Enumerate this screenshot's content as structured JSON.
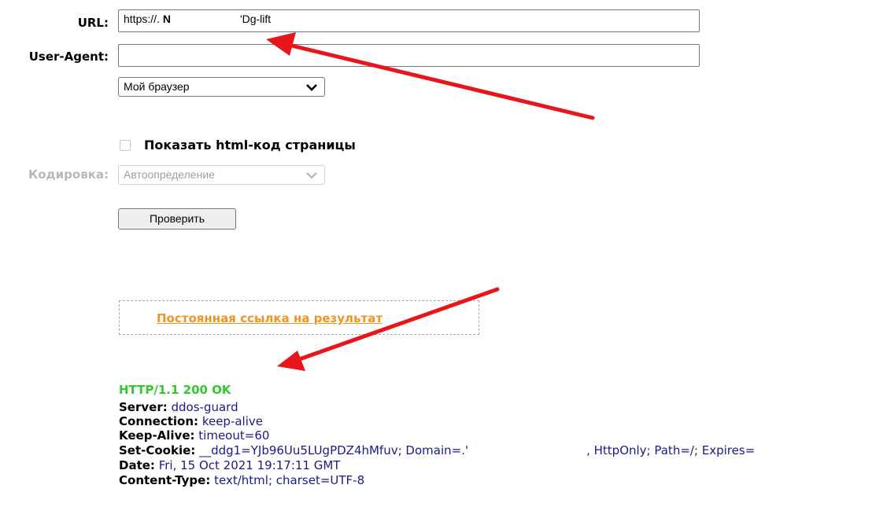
{
  "form": {
    "url_label": "URL:",
    "url_value_start": "https://.",
    "url_value_n": "N",
    "url_value_end": "'Dg-lift",
    "useragent_label": "User-Agent:",
    "useragent_value": "",
    "browser_select_value": "Мой браузер",
    "show_html_label": "Показать html-код страницы",
    "show_html_checked": false,
    "encoding_label": "Кодировка:",
    "encoding_select_value": "Автоопределение",
    "check_button_label": "Проверить"
  },
  "result": {
    "permalink_text": "Постоянная ссылка на результат",
    "status_line": "HTTP/1.1 200 OK",
    "headers": [
      {
        "name": "Server:",
        "value": "ddos-guard"
      },
      {
        "name": "Connection:",
        "value": "keep-alive"
      },
      {
        "name": "Keep-Alive:",
        "value": "timeout=60"
      },
      {
        "name": "Set-Cookie:",
        "value": "__ddg1=YJb96Uu5LUgPDZ4hMfuv; Domain=.'",
        "value_tail": ", HttpOnly; Path=/; Expires="
      },
      {
        "name": "Date:",
        "value": "Fri, 15 Oct 2021 19:17:11 GMT"
      },
      {
        "name": "Content-Type:",
        "value": "text/html; charset=UTF-8"
      }
    ]
  },
  "colors": {
    "status_green": "#32c832",
    "header_value_blue": "#1a1a8c",
    "permalink_orange": "#f29423",
    "arrow_red": "#e8161b",
    "disabled_gray": "#b8b8b8"
  }
}
